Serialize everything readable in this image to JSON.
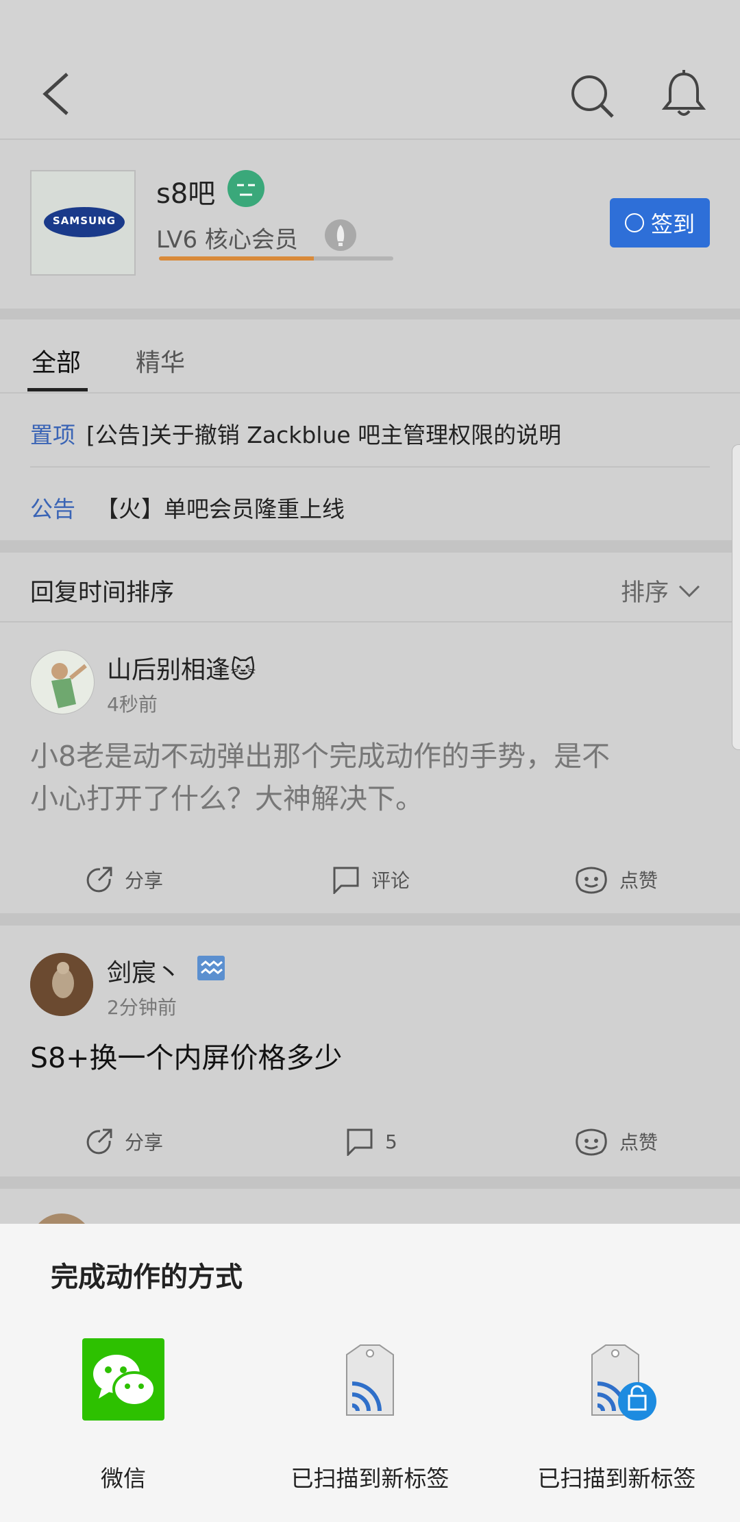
{
  "header": {
    "back_icon": "back-arrow-icon",
    "search_icon": "search-icon",
    "bell_icon": "notification-bell-icon"
  },
  "forum": {
    "name": "s8吧",
    "logo_text": "SAMSUNG",
    "level_text": "LV6 核心会员",
    "level_progress": 0.66,
    "signin_label": "签到",
    "colors": {
      "signin": "#2e6fd8",
      "progress": "#d98a3a"
    }
  },
  "tabs": [
    {
      "label": "全部",
      "active": true
    },
    {
      "label": "精华",
      "active": false
    }
  ],
  "notices": [
    {
      "tag": "置项",
      "text": "[公告]关于撤销 Zackblue 吧主管理权限的说明"
    },
    {
      "tag": "公告",
      "text": "【火】单吧会员隆重上线"
    }
  ],
  "sort": {
    "title": "回复时间排序",
    "button": "排序"
  },
  "posts": [
    {
      "user": "山后别相逢🐱",
      "time": "4秒前",
      "text_line1": "小8老是动不动弹出那个完成动作的手势，是不",
      "text_line2": "小心打开了什么？大神解决下。",
      "share": "分享",
      "comment": "评论",
      "like": "点赞"
    },
    {
      "user": "剑宸丶",
      "time": "2分钟前",
      "text_line1": "S8+换一个内屏价格多少",
      "share": "分享",
      "comment": "5",
      "like": "点赞"
    }
  ],
  "sheet": {
    "title": "完成动作的方式",
    "options": [
      {
        "label": "微信",
        "icon": "wechat-icon"
      },
      {
        "label": "已扫描到新标签",
        "icon": "nfc-tag-icon"
      },
      {
        "label": "已扫描到新标签",
        "icon": "nfc-tag-lock-icon"
      }
    ]
  }
}
